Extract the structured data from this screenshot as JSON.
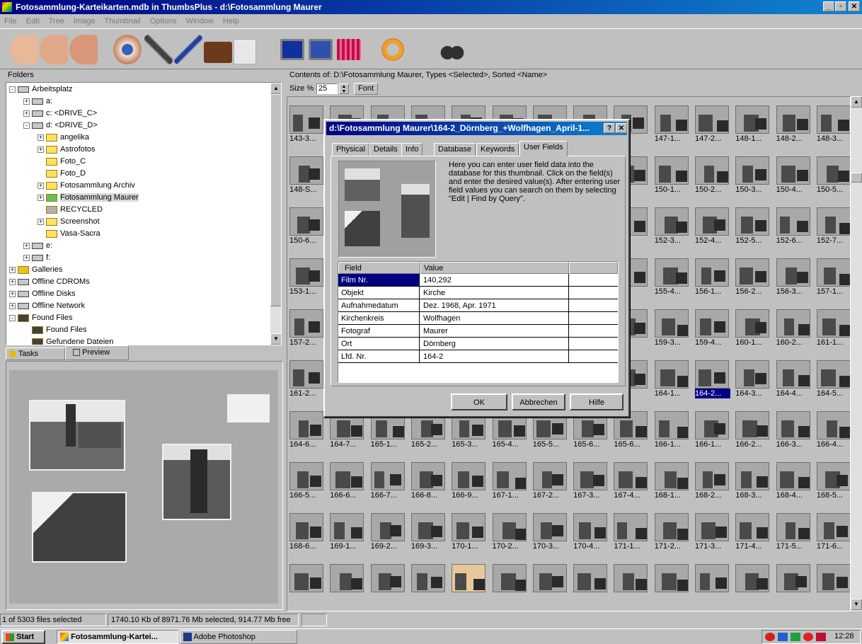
{
  "window": {
    "title": "Fotosammlung-Karteikarten.mdb in ThumbsPlus - d:\\Fotosammlung Maurer",
    "minimize_icon": "minimize-icon",
    "maximize_icon": "restore-icon",
    "close_icon": "close-icon",
    "min": "_",
    "max": "▫",
    "close": "✕"
  },
  "menu": [
    "File",
    "Edit",
    "Tree",
    "Image",
    "Thumbnail",
    "Options",
    "Window",
    "Help"
  ],
  "toolbar": {
    "icons": [
      "hand-select-icon",
      "hand-select-icon",
      "hand-select-icon",
      "eye-view-icon",
      "wrench-icon",
      "paintbrush-icon",
      "briefcase-icon",
      "clipboard-icon",
      "monitor-icon",
      "monitor-icon",
      "gallery-icon",
      "lifebuoy-help-icon",
      "binoculars-icon"
    ]
  },
  "folders": {
    "title": "Folders",
    "items": [
      {
        "label": "Arbeitsplatz",
        "level": 0,
        "toggle": "-",
        "icon": "computer-icon"
      },
      {
        "label": "a:",
        "level": 1,
        "toggle": "+",
        "icon": "drive-icon"
      },
      {
        "label": "c: <DRIVE_C>",
        "level": 1,
        "toggle": "+",
        "icon": "drive-icon"
      },
      {
        "label": "d: <DRIVE_D>",
        "level": 1,
        "toggle": "-",
        "icon": "drive-icon"
      },
      {
        "label": "angelika",
        "level": 2,
        "toggle": "+",
        "icon": "folder-icon"
      },
      {
        "label": "Astrofotos",
        "level": 2,
        "toggle": "+",
        "icon": "folder-icon"
      },
      {
        "label": "Foto_C",
        "level": 2,
        "toggle": "",
        "icon": "folder-icon"
      },
      {
        "label": "Foto_D",
        "level": 2,
        "toggle": "",
        "icon": "folder-icon"
      },
      {
        "label": "Fotosammlung Archiv",
        "level": 2,
        "toggle": "+",
        "icon": "folder-icon"
      },
      {
        "label": "Fotosammlung Maurer",
        "level": 2,
        "toggle": "+",
        "icon": "open-folder-icon",
        "selected": true
      },
      {
        "label": "RECYCLED",
        "level": 2,
        "toggle": "",
        "icon": "recycle-folder-icon"
      },
      {
        "label": "Screenshot",
        "level": 2,
        "toggle": "+",
        "icon": "folder-icon"
      },
      {
        "label": "Vasa-Sacra",
        "level": 2,
        "toggle": "",
        "icon": "folder-icon"
      },
      {
        "label": "e:",
        "level": 1,
        "toggle": "+",
        "icon": "cdrom-icon"
      },
      {
        "label": "f:",
        "level": 1,
        "toggle": "+",
        "icon": "cdrom-icon"
      },
      {
        "label": "Galleries",
        "level": 0,
        "toggle": "+",
        "icon": "galleries-icon"
      },
      {
        "label": "Offline CDROMs",
        "level": 0,
        "toggle": "+",
        "icon": "cdrom-icon"
      },
      {
        "label": "Offline Disks",
        "level": 0,
        "toggle": "+",
        "icon": "disk-icon"
      },
      {
        "label": "Offline Network",
        "level": 0,
        "toggle": "+",
        "icon": "network-icon"
      },
      {
        "label": "Found Files",
        "level": 0,
        "toggle": "-",
        "icon": "binoculars-icon"
      },
      {
        "label": "Found Files",
        "level": 1,
        "toggle": "",
        "icon": "found-files-icon"
      },
      {
        "label": "Gefundene Dateien",
        "level": 1,
        "toggle": "",
        "icon": "found-files-icon"
      }
    ]
  },
  "lower_tabs": {
    "tasks": "Tasks",
    "preview": "Preview",
    "tasks_icon": "tasks-icon",
    "preview_icon": "preview-icon"
  },
  "contents": {
    "header": "Contents of: D:\\Fotosammlung Maurer, Types <Selected>, Sorted <Name>",
    "size_label": "Size %",
    "size_value": "25",
    "font_button": "Font"
  },
  "thumbnails": {
    "rows": [
      [
        "143-3...",
        "",
        "",
        "",
        "",
        "",
        "",
        "",
        "",
        "147-1...",
        "147-2...",
        "148-1...",
        "148-2...",
        "148-3..."
      ],
      [
        "148-S...",
        "",
        "",
        "",
        "",
        "",
        "",
        "",
        "",
        "150-1...",
        "150-2...",
        "150-3...",
        "150-4...",
        "150-5..."
      ],
      [
        "150-6...",
        "",
        "",
        "",
        "",
        "",
        "",
        "",
        "",
        "152-3...",
        "152-4...",
        "152-5...",
        "152-6...",
        "152-7..."
      ],
      [
        "153-1...",
        "",
        "",
        "",
        "",
        "",
        "",
        "",
        "",
        "155-4...",
        "156-1...",
        "156-2...",
        "156-3...",
        "157-1..."
      ],
      [
        "157-2...",
        "",
        "",
        "",
        "",
        "",
        "",
        "",
        "",
        "159-3...",
        "159-4...",
        "160-1...",
        "160-2...",
        "161-1..."
      ],
      [
        "161-2...",
        "",
        "",
        "",
        "",
        "",
        "",
        "",
        "",
        "164-1...",
        "164-2...",
        "164-3...",
        "164-4...",
        "164-5..."
      ],
      [
        "164-6...",
        "164-7...",
        "165-1...",
        "165-2...",
        "165-3...",
        "165-4...",
        "165-5...",
        "165-6...",
        "165-6...",
        "166-1...",
        "166-1...",
        "166-2...",
        "166-3...",
        "166-4..."
      ],
      [
        "166-5...",
        "166-6...",
        "166-7...",
        "166-8...",
        "166-9...",
        "167-1...",
        "167-2...",
        "167-3...",
        "167-4...",
        "168-1...",
        "168-2...",
        "168-3...",
        "168-4...",
        "168-5..."
      ],
      [
        "168-6...",
        "169-1...",
        "169-2...",
        "169-3...",
        "170-1...",
        "170-2...",
        "170-3...",
        "170-4...",
        "171-1...",
        "171-2...",
        "171-3...",
        "171-4...",
        "171-5...",
        "171-6..."
      ],
      [
        "",
        "",
        "",
        "",
        "",
        "",
        "",
        "",
        "",
        "",
        "",
        "",
        "",
        ""
      ]
    ],
    "selected": "164-2..."
  },
  "dialog": {
    "title": "d:\\Fotosammlung Maurer\\164-2_Dörnberg_+Wolfhagen_April-1...",
    "help_btn": "?",
    "close_btn": "✕",
    "tabs": [
      "Physical",
      "Details",
      "Info",
      "Database",
      "Keywords",
      "User Fields"
    ],
    "active_tab": "User Fields",
    "description": "Here you can enter user field data into the database for this thumbnail.  Click on the field(s) and enter the desired value(s).  After entering user field values you can search on them by selecting \"Edit | Find by Query\".",
    "table_headers": {
      "field": "Field",
      "value": "Value"
    },
    "fields": [
      {
        "field": "Film Nr.",
        "value": "140,292"
      },
      {
        "field": "Objekt",
        "value": "Kirche"
      },
      {
        "field": "Aufnahmedatum",
        "value": "Dez. 1968, Apr. 1971"
      },
      {
        "field": "Kirchenkreis",
        "value": "Wolfhagen"
      },
      {
        "field": "Fotograf",
        "value": "Maurer"
      },
      {
        "field": "Ort",
        "value": "Dörnberg"
      },
      {
        "field": "Lfd. Nr.",
        "value": "164-2"
      }
    ],
    "ok": "OK",
    "cancel": "Abbrechen",
    "help": "Hilfe"
  },
  "status": {
    "count": "1 of 5303 files selected",
    "size": "1740.10 Kb of 8971.76 Mb selected, 914.77 Mb free"
  },
  "taskbar": {
    "start": "Start",
    "start_icon": "windows-logo-icon",
    "items": [
      {
        "label": "Fotosammlung-Kartei...",
        "icon": "thumbsplus-icon",
        "active": true
      },
      {
        "label": "Adobe Photoshop",
        "icon": "photoshop-icon",
        "active": false
      }
    ],
    "clock": "12:28"
  },
  "colors": {
    "title": "#000080",
    "selection": "#000080",
    "face": "#c0c0c0"
  }
}
